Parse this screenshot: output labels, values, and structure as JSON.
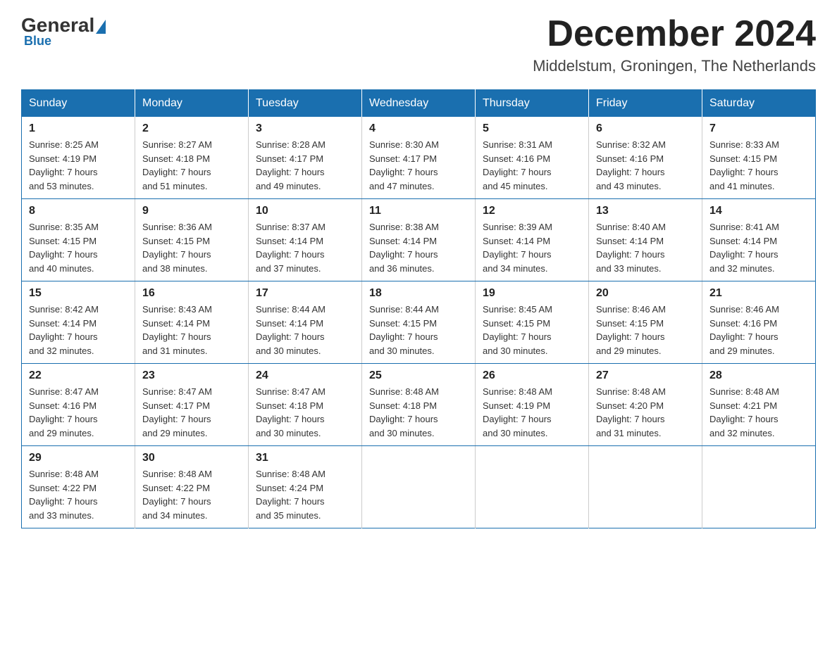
{
  "header": {
    "logo": {
      "general": "General",
      "blue": "Blue"
    },
    "title": "December 2024",
    "location": "Middelstum, Groningen, The Netherlands"
  },
  "weekdays": [
    "Sunday",
    "Monday",
    "Tuesday",
    "Wednesday",
    "Thursday",
    "Friday",
    "Saturday"
  ],
  "weeks": [
    [
      {
        "day": "1",
        "sunrise": "8:25 AM",
        "sunset": "4:19 PM",
        "daylight": "7 hours and 53 minutes."
      },
      {
        "day": "2",
        "sunrise": "8:27 AM",
        "sunset": "4:18 PM",
        "daylight": "7 hours and 51 minutes."
      },
      {
        "day": "3",
        "sunrise": "8:28 AM",
        "sunset": "4:17 PM",
        "daylight": "7 hours and 49 minutes."
      },
      {
        "day": "4",
        "sunrise": "8:30 AM",
        "sunset": "4:17 PM",
        "daylight": "7 hours and 47 minutes."
      },
      {
        "day": "5",
        "sunrise": "8:31 AM",
        "sunset": "4:16 PM",
        "daylight": "7 hours and 45 minutes."
      },
      {
        "day": "6",
        "sunrise": "8:32 AM",
        "sunset": "4:16 PM",
        "daylight": "7 hours and 43 minutes."
      },
      {
        "day": "7",
        "sunrise": "8:33 AM",
        "sunset": "4:15 PM",
        "daylight": "7 hours and 41 minutes."
      }
    ],
    [
      {
        "day": "8",
        "sunrise": "8:35 AM",
        "sunset": "4:15 PM",
        "daylight": "7 hours and 40 minutes."
      },
      {
        "day": "9",
        "sunrise": "8:36 AM",
        "sunset": "4:15 PM",
        "daylight": "7 hours and 38 minutes."
      },
      {
        "day": "10",
        "sunrise": "8:37 AM",
        "sunset": "4:14 PM",
        "daylight": "7 hours and 37 minutes."
      },
      {
        "day": "11",
        "sunrise": "8:38 AM",
        "sunset": "4:14 PM",
        "daylight": "7 hours and 36 minutes."
      },
      {
        "day": "12",
        "sunrise": "8:39 AM",
        "sunset": "4:14 PM",
        "daylight": "7 hours and 34 minutes."
      },
      {
        "day": "13",
        "sunrise": "8:40 AM",
        "sunset": "4:14 PM",
        "daylight": "7 hours and 33 minutes."
      },
      {
        "day": "14",
        "sunrise": "8:41 AM",
        "sunset": "4:14 PM",
        "daylight": "7 hours and 32 minutes."
      }
    ],
    [
      {
        "day": "15",
        "sunrise": "8:42 AM",
        "sunset": "4:14 PM",
        "daylight": "7 hours and 32 minutes."
      },
      {
        "day": "16",
        "sunrise": "8:43 AM",
        "sunset": "4:14 PM",
        "daylight": "7 hours and 31 minutes."
      },
      {
        "day": "17",
        "sunrise": "8:44 AM",
        "sunset": "4:14 PM",
        "daylight": "7 hours and 30 minutes."
      },
      {
        "day": "18",
        "sunrise": "8:44 AM",
        "sunset": "4:15 PM",
        "daylight": "7 hours and 30 minutes."
      },
      {
        "day": "19",
        "sunrise": "8:45 AM",
        "sunset": "4:15 PM",
        "daylight": "7 hours and 30 minutes."
      },
      {
        "day": "20",
        "sunrise": "8:46 AM",
        "sunset": "4:15 PM",
        "daylight": "7 hours and 29 minutes."
      },
      {
        "day": "21",
        "sunrise": "8:46 AM",
        "sunset": "4:16 PM",
        "daylight": "7 hours and 29 minutes."
      }
    ],
    [
      {
        "day": "22",
        "sunrise": "8:47 AM",
        "sunset": "4:16 PM",
        "daylight": "7 hours and 29 minutes."
      },
      {
        "day": "23",
        "sunrise": "8:47 AM",
        "sunset": "4:17 PM",
        "daylight": "7 hours and 29 minutes."
      },
      {
        "day": "24",
        "sunrise": "8:47 AM",
        "sunset": "4:18 PM",
        "daylight": "7 hours and 30 minutes."
      },
      {
        "day": "25",
        "sunrise": "8:48 AM",
        "sunset": "4:18 PM",
        "daylight": "7 hours and 30 minutes."
      },
      {
        "day": "26",
        "sunrise": "8:48 AM",
        "sunset": "4:19 PM",
        "daylight": "7 hours and 30 minutes."
      },
      {
        "day": "27",
        "sunrise": "8:48 AM",
        "sunset": "4:20 PM",
        "daylight": "7 hours and 31 minutes."
      },
      {
        "day": "28",
        "sunrise": "8:48 AM",
        "sunset": "4:21 PM",
        "daylight": "7 hours and 32 minutes."
      }
    ],
    [
      {
        "day": "29",
        "sunrise": "8:48 AM",
        "sunset": "4:22 PM",
        "daylight": "7 hours and 33 minutes."
      },
      {
        "day": "30",
        "sunrise": "8:48 AM",
        "sunset": "4:22 PM",
        "daylight": "7 hours and 34 minutes."
      },
      {
        "day": "31",
        "sunrise": "8:48 AM",
        "sunset": "4:24 PM",
        "daylight": "7 hours and 35 minutes."
      },
      null,
      null,
      null,
      null
    ]
  ],
  "labels": {
    "sunrise": "Sunrise:",
    "sunset": "Sunset:",
    "daylight": "Daylight:"
  }
}
